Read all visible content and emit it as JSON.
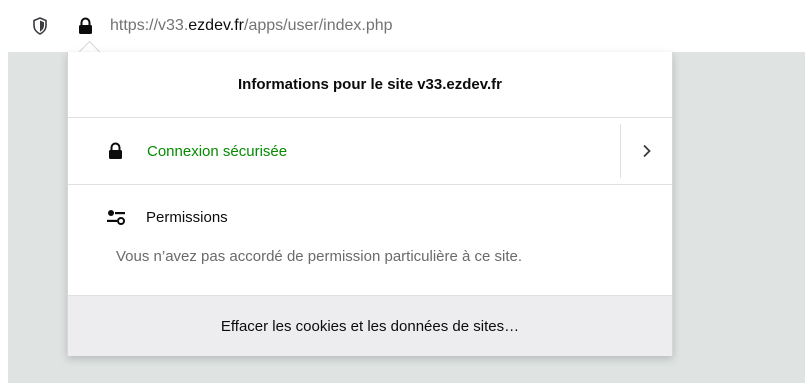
{
  "urlbar": {
    "url_prefix": "https://v33.",
    "url_domain": "ezdev.fr",
    "url_path": "/apps/user/index.php"
  },
  "popup": {
    "title": "Informations pour le site v33.ezdev.fr",
    "connection": {
      "label": "Connexion sécurisée",
      "status_color": "#058b00"
    },
    "permissions": {
      "title": "Permissions",
      "description": "Vous n’avez pas accordé de permission particulière à ce site."
    },
    "clear_button_label": "Effacer les cookies et les données de sites…"
  },
  "icons": {
    "tracking": "shield-icon",
    "site_info": "lock-icon",
    "connection": "lock-icon",
    "expand": "chevron-right-icon",
    "permissions": "permissions-icon"
  }
}
